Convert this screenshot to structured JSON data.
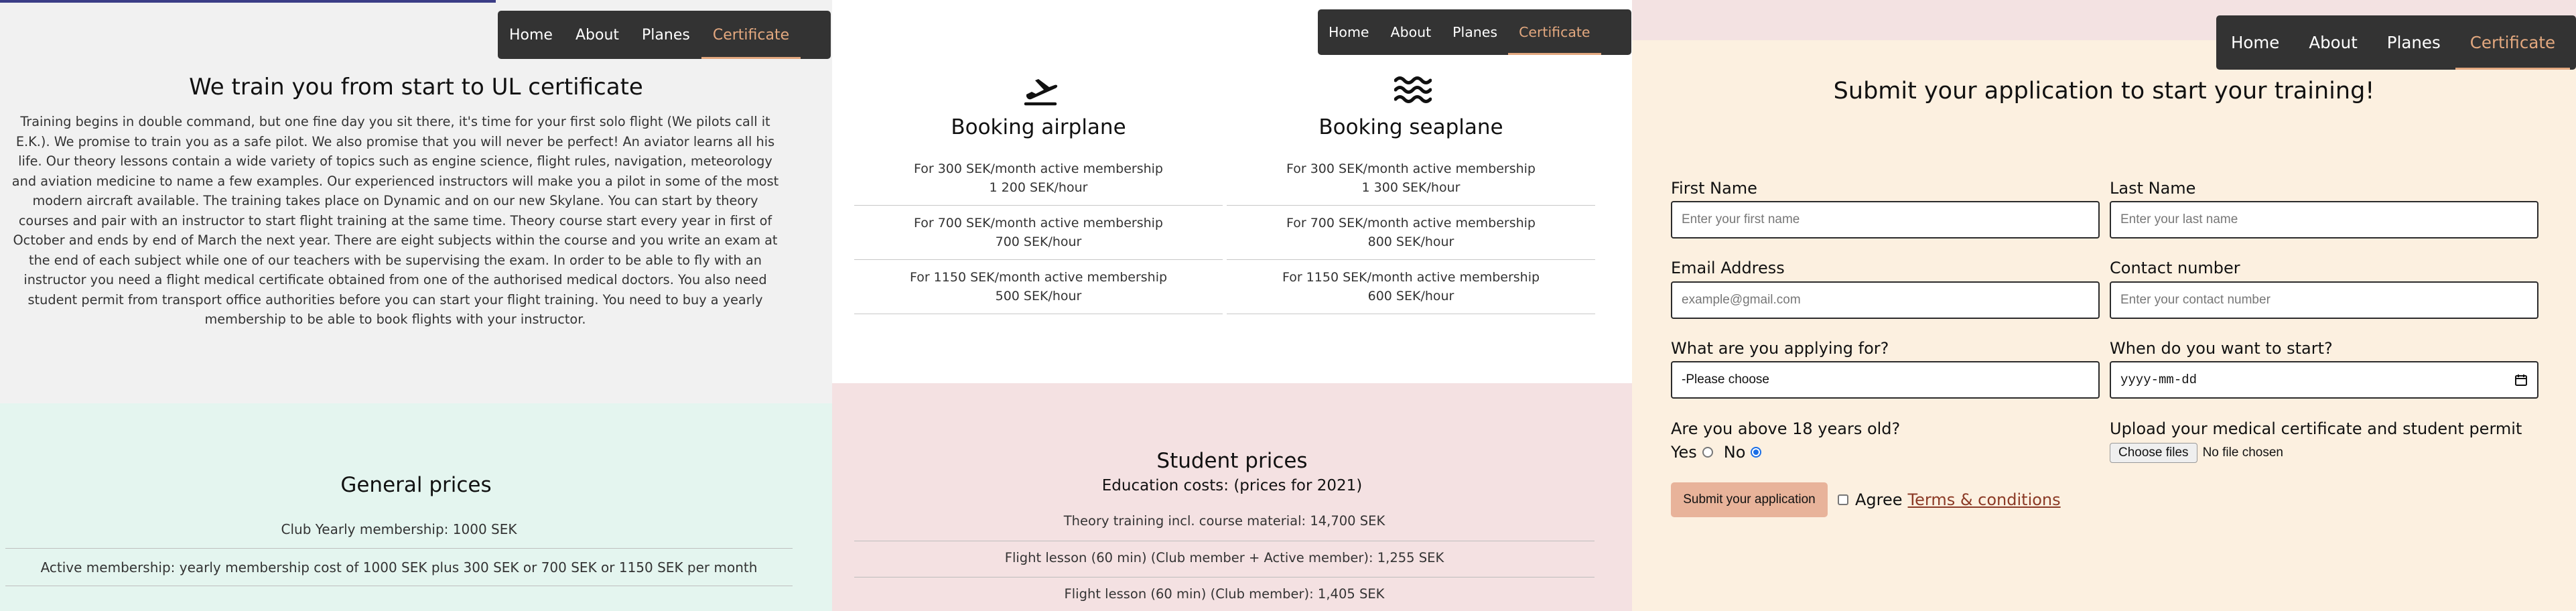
{
  "nav": {
    "items": [
      "Home",
      "About",
      "Planes",
      "Certificate"
    ],
    "active": "Certificate"
  },
  "panel1": {
    "title": "We train you from start to UL certificate",
    "intro": "Training begins in double command, but one fine day you sit there, it's time for your first solo flight (We pilots call it E.K.). We promise to train you as a safe pilot. We also promise that you will never be perfect! An aviator learns all his life. Our theory lessons contain a wide variety of topics such as engine science, flight rules, navigation, meteorology and aviation medicine to name a few examples. Our experienced instructors will make you a pilot in some of the most modern aircraft available. The training takes place on Dynamic and on our new Skylane. You can start by theory courses and pair with an instructor to start flight training at the same time. Theory course start every year in first of October and ends by end of March the next year. There are eight subjects within the course and you write an exam at the end of each subject while one of our teachers with be supervising the exam. In order to be able to fly with an instructor you need a flight medical certificate obtained from one of the authorised medical doctors. You also need student permit from transport office authorities before you can start your flight training. You need to buy a yearly membership to be able to book flights with your instructor.",
    "general_title": "General prices",
    "general_prices": [
      "Club Yearly membership: 1000 SEK",
      "Active membership: yearly membership cost of 1000 SEK plus 300 SEK or 700 SEK or 1150 SEK per month"
    ]
  },
  "panel2": {
    "bookings": [
      {
        "icon": "airplane-icon",
        "title": "Booking airplane",
        "options": [
          {
            "membership": "For 300 SEK/month active membership",
            "rate": "1 200 SEK/hour"
          },
          {
            "membership": "For 700 SEK/month active membership",
            "rate": "700 SEK/hour"
          },
          {
            "membership": "For 1150 SEK/month active membership",
            "rate": "500 SEK/hour"
          }
        ]
      },
      {
        "icon": "water-waves-icon",
        "title": "Booking seaplane",
        "options": [
          {
            "membership": "For 300 SEK/month active membership",
            "rate": "1 300 SEK/hour"
          },
          {
            "membership": "For 700 SEK/month active membership",
            "rate": "800 SEK/hour"
          },
          {
            "membership": "For 1150 SEK/month active membership",
            "rate": "600 SEK/hour"
          }
        ]
      }
    ],
    "student_title": "Student prices",
    "student_subtitle": "Education costs: (prices for 2021)",
    "student_prices": [
      "Theory training incl. course material: 14,700 SEK",
      "Flight lesson (60 min) (Club member + Active member): 1,255 SEK",
      "Flight lesson (60 min) (Club member): 1,405 SEK"
    ]
  },
  "panel3": {
    "title": "Submit your application to start your training!",
    "first_name": {
      "label": "First Name",
      "placeholder": "Enter your first name"
    },
    "last_name": {
      "label": "Last Name",
      "placeholder": "Enter your last name"
    },
    "email": {
      "label": "Email Address",
      "placeholder": "example@gmail.com"
    },
    "contact": {
      "label": "Contact number",
      "placeholder": "Enter your contact number"
    },
    "applying_for": {
      "label": "What are you applying for?",
      "selected": "-Please choose"
    },
    "start_date": {
      "label": "When do you want to start?",
      "value": "yyyy-mm-dd"
    },
    "age_question": {
      "label": "Are you above 18 years old?",
      "yes": "Yes",
      "no": "No",
      "selected": "No"
    },
    "upload": {
      "label": "Upload your medical certificate and student permit",
      "button": "Choose files",
      "status": "No file chosen"
    },
    "submit_label": "Submit your application",
    "agree_label": "Agree",
    "terms_label": "Terms & conditions"
  },
  "colors": {
    "nav_bg": "#333333",
    "nav_active": "#e3a87f",
    "general_bg": "#e4f5ef",
    "student_bg": "#f4e1e2",
    "form_bg": "#fcf0e0",
    "submit_bg": "#e8b39a",
    "terms_link": "#8b3a26"
  }
}
